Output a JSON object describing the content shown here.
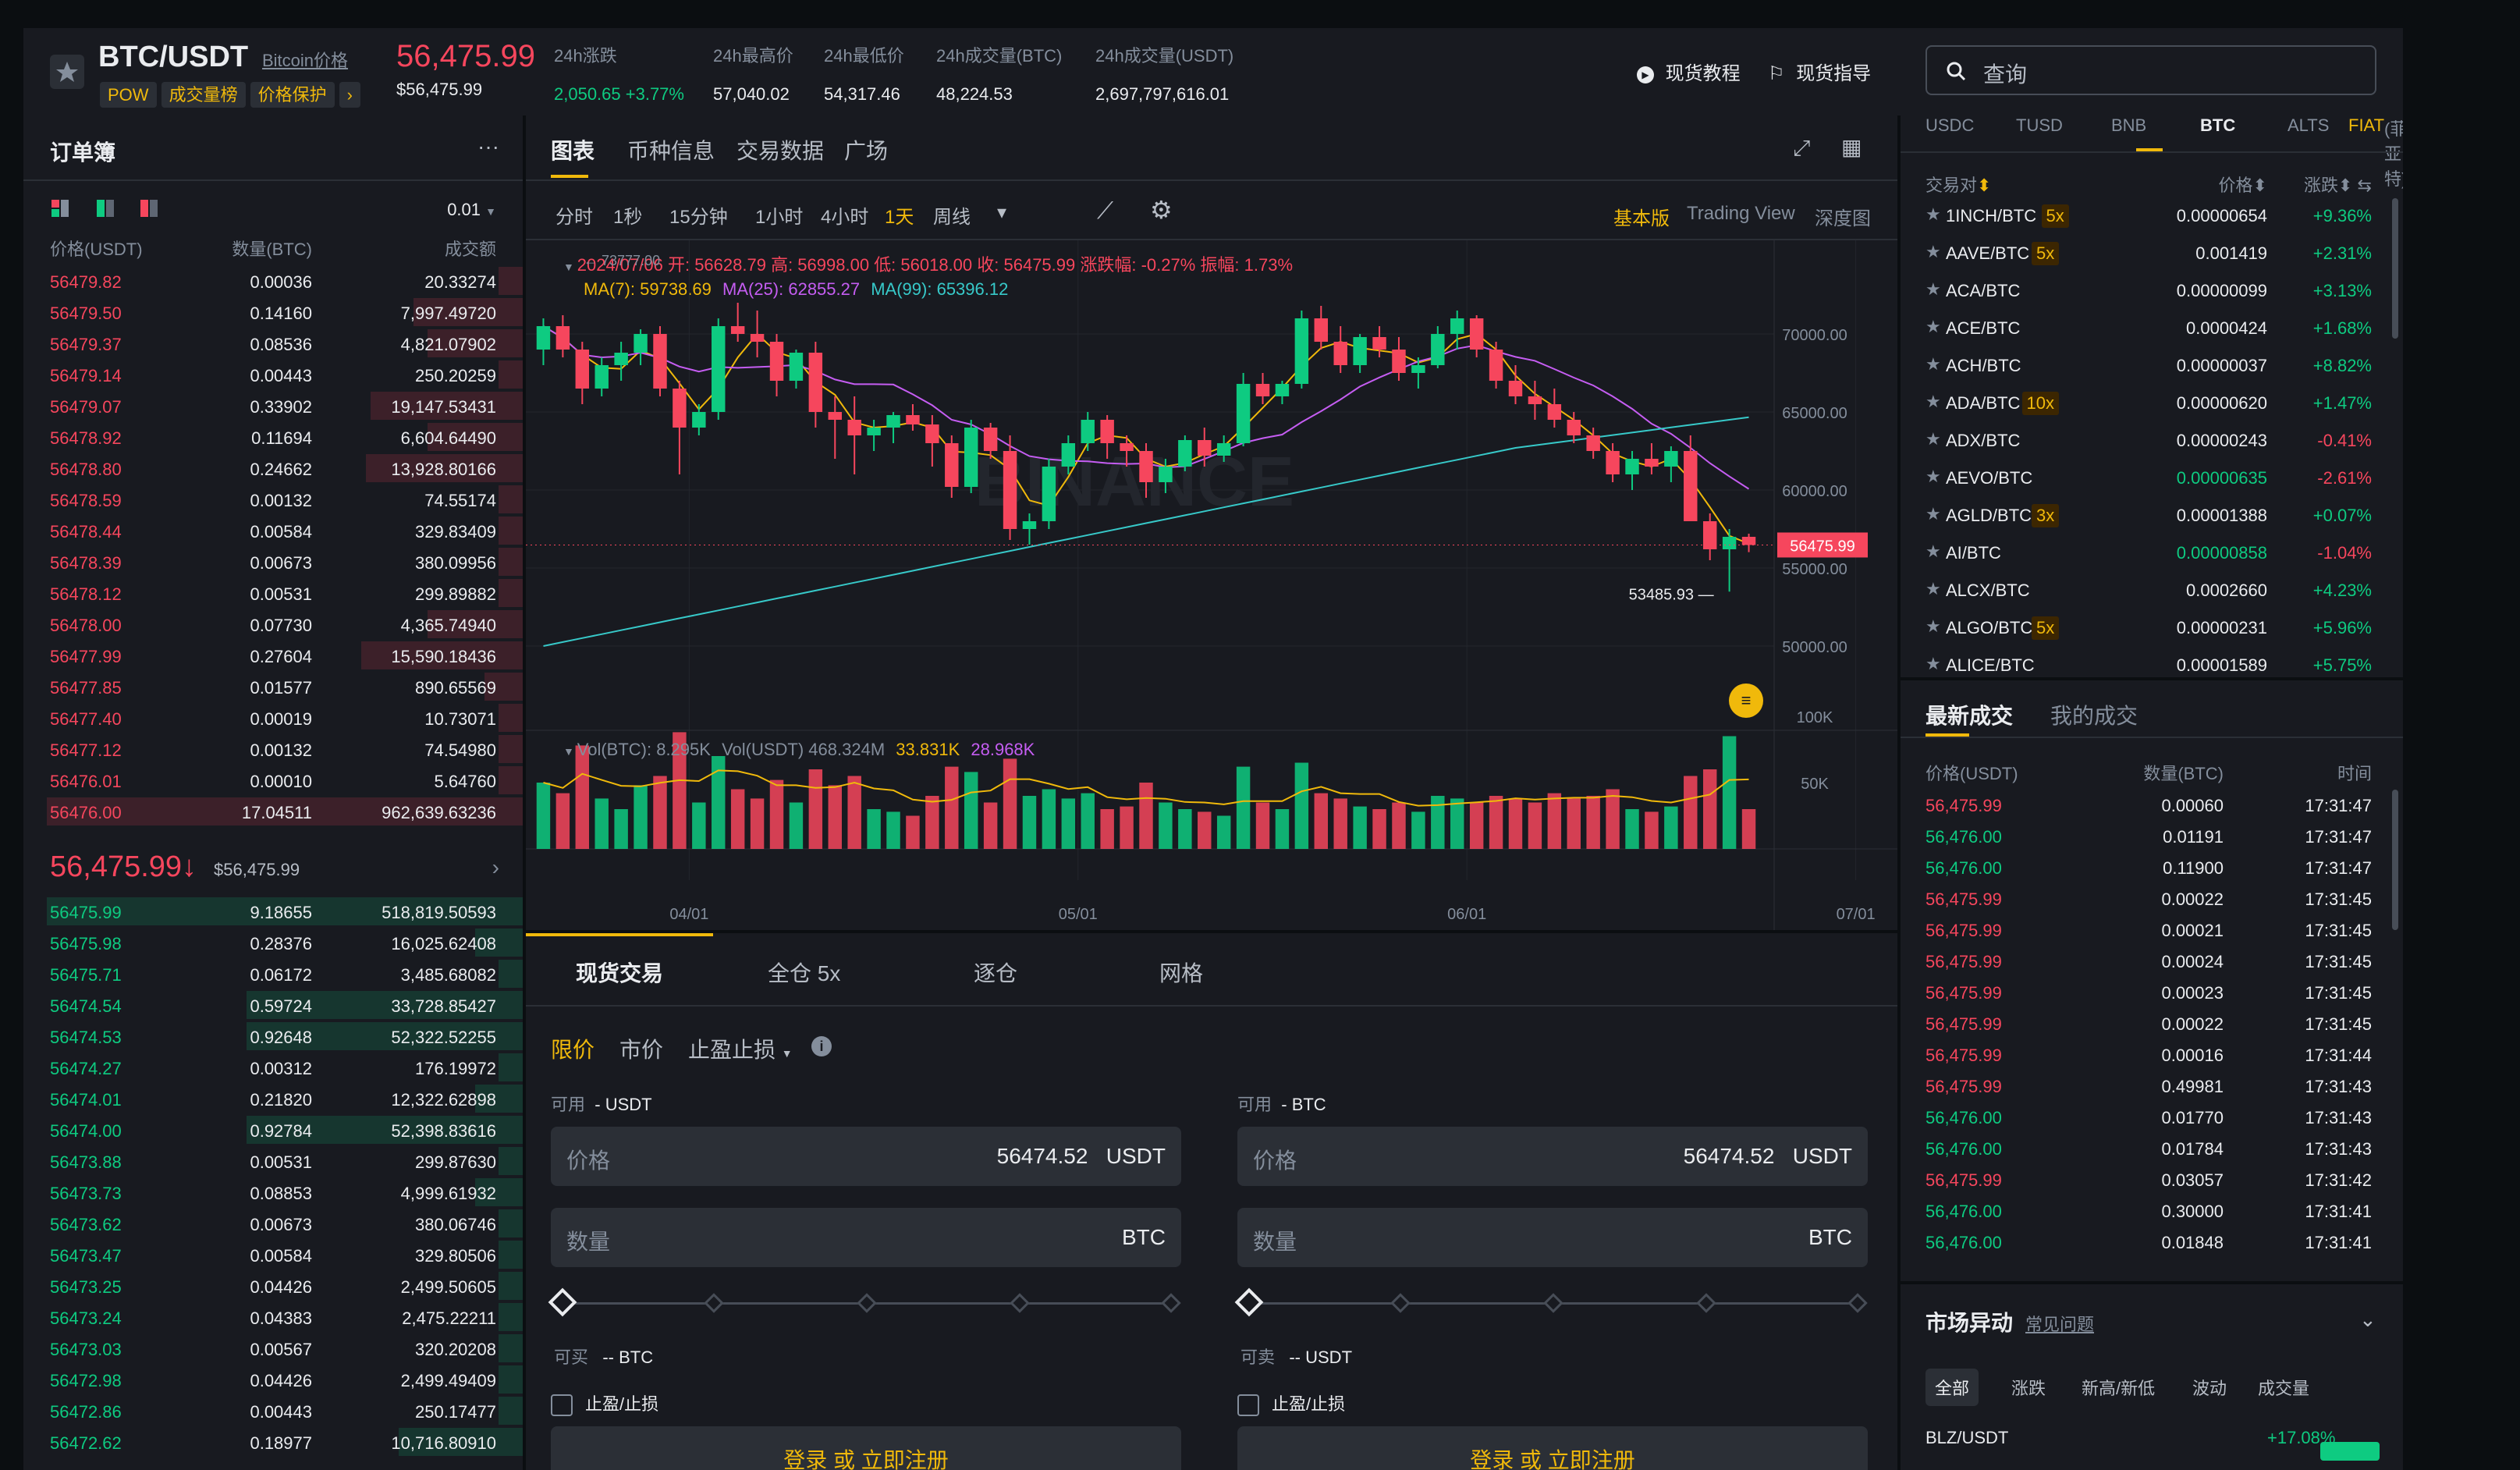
{
  "header": {
    "pair": "BTC/USDT",
    "link": "Bitcoin价格",
    "price": "56,475.99",
    "price_usd": "$56,475.99",
    "tags": [
      "POW",
      "成交量榜",
      "价格保护",
      "›"
    ],
    "stats": [
      {
        "label": "24h涨跌",
        "value": "2,050.65 +3.77%"
      },
      {
        "label": "24h最高价",
        "value": "57,040.02"
      },
      {
        "label": "24h最低价",
        "value": "54,317.46"
      },
      {
        "label": "24h成交量(BTC)",
        "value": "48,224.53"
      },
      {
        "label": "24h成交量(USDT)",
        "value": "2,697,797,616.01"
      }
    ],
    "tutorial": "现货教程",
    "guide": "现货指导"
  },
  "orderbook": {
    "title": "订单簿",
    "more": "···",
    "precision": "0.01",
    "cols": [
      "价格(USDT)",
      "数量(BTC)",
      "成交额"
    ],
    "asks": [
      [
        "56479.82",
        "0.00036",
        "20.33274"
      ],
      [
        "56479.50",
        "0.14160",
        "7,997.49720"
      ],
      [
        "56479.37",
        "0.08536",
        "4,821.07902"
      ],
      [
        "56479.14",
        "0.00443",
        "250.20259"
      ],
      [
        "56479.07",
        "0.33902",
        "19,147.53431"
      ],
      [
        "56478.92",
        "0.11694",
        "6,604.64490"
      ],
      [
        "56478.80",
        "0.24662",
        "13,928.80166"
      ],
      [
        "56478.59",
        "0.00132",
        "74.55174"
      ],
      [
        "56478.44",
        "0.00584",
        "329.83409"
      ],
      [
        "56478.39",
        "0.00673",
        "380.09956"
      ],
      [
        "56478.12",
        "0.00531",
        "299.89882"
      ],
      [
        "56478.00",
        "0.07730",
        "4,365.74940"
      ],
      [
        "56477.99",
        "0.27604",
        "15,590.18436"
      ],
      [
        "56477.85",
        "0.01577",
        "890.65569"
      ],
      [
        "56477.40",
        "0.00019",
        "10.73071"
      ],
      [
        "56477.12",
        "0.00132",
        "74.54980"
      ],
      [
        "56476.01",
        "0.00010",
        "5.64760"
      ],
      [
        "56476.00",
        "17.04511",
        "962,639.63236"
      ]
    ],
    "ask_depth": [
      0.05,
      0.23,
      0.2,
      0.05,
      0.32,
      0.2,
      0.33,
      0.05,
      0.05,
      0.05,
      0.05,
      0.2,
      0.34,
      0.08,
      0.05,
      0.05,
      0.05,
      1.0
    ],
    "mid_price": "56,475.99↓",
    "mid_usd": "$56,475.99",
    "mid_arrow": "›",
    "bids": [
      [
        "56475.99",
        "9.18655",
        "518,819.50593"
      ],
      [
        "56475.98",
        "0.28376",
        "16,025.62408"
      ],
      [
        "56475.71",
        "0.06172",
        "3,485.68082"
      ],
      [
        "56474.54",
        "0.59724",
        "33,728.85427"
      ],
      [
        "56474.53",
        "0.92648",
        "52,322.52255"
      ],
      [
        "56474.27",
        "0.00312",
        "176.19972"
      ],
      [
        "56474.01",
        "0.21820",
        "12,322.62898"
      ],
      [
        "56474.00",
        "0.92784",
        "52,398.83616"
      ],
      [
        "56473.88",
        "0.00531",
        "299.87630"
      ],
      [
        "56473.73",
        "0.08853",
        "4,999.61932"
      ],
      [
        "56473.62",
        "0.00673",
        "380.06746"
      ],
      [
        "56473.47",
        "0.00584",
        "329.80506"
      ],
      [
        "56473.25",
        "0.04426",
        "2,499.50605"
      ],
      [
        "56473.24",
        "0.04383",
        "2,475.22211"
      ],
      [
        "56473.03",
        "0.00567",
        "320.20208"
      ],
      [
        "56472.98",
        "0.04426",
        "2,499.49409"
      ],
      [
        "56472.86",
        "0.00443",
        "250.17477"
      ],
      [
        "56472.62",
        "0.18977",
        "10,716.80910"
      ]
    ],
    "bid_depth": [
      1.0,
      0.1,
      0.05,
      0.58,
      0.58,
      0.05,
      0.1,
      0.58,
      0.05,
      0.1,
      0.05,
      0.05,
      0.05,
      0.05,
      0.05,
      0.05,
      0.05,
      0.26
    ]
  },
  "chart": {
    "tabs": [
      "图表",
      "币种信息",
      "交易数据",
      "广场"
    ],
    "intervals": [
      "分时",
      "1秒",
      "15分钟",
      "1小时",
      "4小时",
      "1天",
      "周线",
      "▾"
    ],
    "views": [
      "基本版",
      "Trading View",
      "深度图"
    ],
    "ohlc_label": "2024/07/06 开: 56628.79 高: 56998.00 低: 56018.00 收: 56475.99 涨跌幅: -0.27% 振幅: 1.73%",
    "ma": {
      "ma7": "MA(7): 59738.69",
      "ma25": "MA(25): 62855.27",
      "ma99": "MA(99): 65396.12"
    },
    "high_mark": "73777.00",
    "low_mark": "53485.93",
    "last": "56475.99",
    "vol_label": {
      "v1": "Vol(BTC): 8.295K",
      "v2": "Vol(USDT) 468.324M",
      "v3": "33.831K",
      "v4": "28.968K"
    },
    "watermark": "BINANCE"
  },
  "chart_data": {
    "type": "line",
    "ylim": [
      45000,
      75000
    ],
    "y_ticks": [
      "70000.00",
      "65000.00",
      "60000.00",
      "55000.00",
      "50000.00"
    ],
    "x_ticks": [
      "04/01",
      "05/01",
      "06/01",
      "07/01"
    ],
    "vol_ticks": [
      "100K",
      "50K"
    ],
    "candles": [
      [
        69000,
        71000,
        68000,
        70500
      ],
      [
        70500,
        71200,
        68500,
        69000
      ],
      [
        69000,
        69500,
        65500,
        66500
      ],
      [
        66500,
        68500,
        66000,
        68000
      ],
      [
        68000,
        69500,
        67000,
        68800
      ],
      [
        68800,
        70300,
        68000,
        70000
      ],
      [
        70000,
        70500,
        66000,
        66500
      ],
      [
        66500,
        67000,
        61000,
        64000
      ],
      [
        64000,
        65500,
        63500,
        65000
      ],
      [
        65000,
        71000,
        64500,
        70500
      ],
      [
        70500,
        72000,
        69500,
        70000
      ],
      [
        70000,
        71500,
        68500,
        69500
      ],
      [
        69500,
        70000,
        66000,
        67000
      ],
      [
        67000,
        69000,
        66500,
        68800
      ],
      [
        68800,
        69500,
        64000,
        65000
      ],
      [
        65000,
        66000,
        62000,
        64500
      ],
      [
        64500,
        66000,
        61000,
        63500
      ],
      [
        63500,
        64500,
        62500,
        64000
      ],
      [
        64000,
        65000,
        63000,
        64800
      ],
      [
        64800,
        65500,
        63800,
        64200
      ],
      [
        64200,
        64800,
        61500,
        63000
      ],
      [
        63000,
        63500,
        59500,
        60200
      ],
      [
        60200,
        64500,
        59800,
        64000
      ],
      [
        64000,
        64300,
        62000,
        62500
      ],
      [
        62500,
        63500,
        56800,
        57500
      ],
      [
        57500,
        58500,
        56500,
        58000
      ],
      [
        58000,
        62000,
        57500,
        61500
      ],
      [
        61500,
        63500,
        61000,
        63000
      ],
      [
        63000,
        65000,
        62500,
        64500
      ],
      [
        64500,
        64800,
        62000,
        63000
      ],
      [
        63000,
        63500,
        61500,
        62500
      ],
      [
        62500,
        63000,
        59500,
        60500
      ],
      [
        60500,
        62000,
        59800,
        61500
      ],
      [
        61500,
        63500,
        61200,
        63200
      ],
      [
        63200,
        64000,
        61500,
        62200
      ],
      [
        62200,
        63500,
        61800,
        63000
      ],
      [
        63000,
        67500,
        62800,
        66800
      ],
      [
        66800,
        67500,
        65500,
        66000
      ],
      [
        66000,
        67000,
        65500,
        66800
      ],
      [
        66800,
        71500,
        66500,
        71000
      ],
      [
        71000,
        71800,
        69000,
        69500
      ],
      [
        69500,
        70500,
        67500,
        68000
      ],
      [
        68000,
        70000,
        67500,
        69800
      ],
      [
        69800,
        70500,
        68500,
        69000
      ],
      [
        69000,
        69800,
        67000,
        67500
      ],
      [
        67500,
        68500,
        66500,
        68000
      ],
      [
        68000,
        70500,
        67800,
        70000
      ],
      [
        70000,
        71500,
        69000,
        71000
      ],
      [
        71000,
        71200,
        68500,
        69000
      ],
      [
        69000,
        69500,
        66500,
        67000
      ],
      [
        67000,
        68000,
        65500,
        66000
      ],
      [
        66000,
        67000,
        64500,
        65500
      ],
      [
        65500,
        66500,
        64000,
        64500
      ],
      [
        64500,
        65000,
        63000,
        63500
      ],
      [
        63500,
        64000,
        62000,
        62500
      ],
      [
        62500,
        63000,
        60500,
        61000
      ],
      [
        61000,
        62500,
        60000,
        62000
      ],
      [
        62000,
        63000,
        61000,
        61500
      ],
      [
        61500,
        62800,
        60500,
        62500
      ],
      [
        62500,
        63500,
        58500,
        58000
      ],
      [
        58000,
        58500,
        55500,
        56200
      ],
      [
        56200,
        57500,
        53485,
        57000
      ],
      [
        57000,
        57200,
        56018,
        56476
      ]
    ],
    "volume": [
      50,
      42,
      78,
      38,
      30,
      48,
      55,
      88,
      35,
      70,
      45,
      38,
      52,
      35,
      60,
      48,
      55,
      30,
      28,
      25,
      40,
      62,
      58,
      35,
      68,
      40,
      45,
      38,
      42,
      30,
      32,
      50,
      35,
      30,
      28,
      25,
      62,
      35,
      30,
      65,
      42,
      38,
      32,
      30,
      35,
      28,
      40,
      38,
      35,
      40,
      38,
      35,
      42,
      38,
      40,
      45,
      30,
      28,
      32,
      55,
      60,
      85,
      30
    ]
  },
  "trade": {
    "tabs": [
      "现货交易",
      "全仓 5x",
      "逐仓",
      "网格"
    ],
    "types": [
      "限价",
      "市价",
      "止盈止损"
    ],
    "buy": {
      "avail_l": "可用",
      "avail_v": "- USDT",
      "price_l": "价格",
      "price_v": "56474.52",
      "price_u": "USDT",
      "qty_l": "数量",
      "qty_u": "BTC",
      "can_l": "可买",
      "can_v": "-- BTC",
      "tpsl": "止盈/止损",
      "btn": "登录 或 立即注册"
    },
    "sell": {
      "avail_l": "可用",
      "avail_v": "- BTC",
      "price_l": "价格",
      "price_v": "56474.52",
      "price_u": "USDT",
      "qty_l": "数量",
      "qty_u": "BTC",
      "can_l": "可卖",
      "can_v": "-- USDT",
      "tpsl": "止盈/止损",
      "btn": "登录 或 立即注册"
    }
  },
  "markets": {
    "search": "查询",
    "tabs": [
      "USDC",
      "TUSD",
      "BNB",
      "BTC",
      "ALTS",
      "FIAT",
      "(菲亚特)"
    ],
    "cols": [
      "交易对",
      "价格",
      "涨跌"
    ],
    "rows": [
      [
        "1INCH/BTC",
        "5x",
        "0.00000654",
        "+9.36%",
        "up"
      ],
      [
        "AAVE/BTC",
        "5x",
        "0.001419",
        "+2.31%",
        "up"
      ],
      [
        "ACA/BTC",
        "",
        "0.00000099",
        "+3.13%",
        "up"
      ],
      [
        "ACE/BTC",
        "",
        "0.0000424",
        "+1.68%",
        "up"
      ],
      [
        "ACH/BTC",
        "",
        "0.00000037",
        "+8.82%",
        "up"
      ],
      [
        "ADA/BTC",
        "10x",
        "0.00000620",
        "+1.47%",
        "up"
      ],
      [
        "ADX/BTC",
        "",
        "0.00000243",
        "-0.41%",
        "dn"
      ],
      [
        "AEVO/BTC",
        "",
        "0.00000635",
        "-2.61%",
        "dn"
      ],
      [
        "AGLD/BTC",
        "3x",
        "0.00001388",
        "+0.07%",
        "up"
      ],
      [
        "AI/BTC",
        "",
        "0.00000858",
        "-1.04%",
        "dn"
      ],
      [
        "ALCX/BTC",
        "",
        "0.0002660",
        "+4.23%",
        "up"
      ],
      [
        "ALGO/BTC",
        "5x",
        "0.00000231",
        "+5.96%",
        "up"
      ],
      [
        "ALICE/BTC",
        "",
        "0.00001589",
        "+5.75%",
        "up"
      ]
    ],
    "price_colors": [
      "w",
      "w",
      "w",
      "w",
      "w",
      "w",
      "w",
      "up",
      "w",
      "up",
      "w",
      "w",
      "w"
    ]
  },
  "recent": {
    "tabs": [
      "最新成交",
      "我的成交"
    ],
    "cols": [
      "价格(USDT)",
      "数量(BTC)",
      "时间"
    ],
    "rows": [
      [
        "56,475.99",
        "0.00060",
        "17:31:47",
        "dn"
      ],
      [
        "56,476.00",
        "0.01191",
        "17:31:47",
        "up"
      ],
      [
        "56,476.00",
        "0.11900",
        "17:31:47",
        "up"
      ],
      [
        "56,475.99",
        "0.00022",
        "17:31:45",
        "dn"
      ],
      [
        "56,475.99",
        "0.00021",
        "17:31:45",
        "dn"
      ],
      [
        "56,475.99",
        "0.00024",
        "17:31:45",
        "dn"
      ],
      [
        "56,475.99",
        "0.00023",
        "17:31:45",
        "dn"
      ],
      [
        "56,475.99",
        "0.00022",
        "17:31:45",
        "dn"
      ],
      [
        "56,475.99",
        "0.00016",
        "17:31:44",
        "dn"
      ],
      [
        "56,475.99",
        "0.49981",
        "17:31:43",
        "dn"
      ],
      [
        "56,476.00",
        "0.01770",
        "17:31:43",
        "up"
      ],
      [
        "56,476.00",
        "0.01784",
        "17:31:43",
        "up"
      ],
      [
        "56,475.99",
        "0.03057",
        "17:31:42",
        "dn"
      ],
      [
        "56,476.00",
        "0.30000",
        "17:31:41",
        "up"
      ],
      [
        "56,476.00",
        "0.01848",
        "17:31:41",
        "up"
      ]
    ]
  },
  "movers": {
    "title": "市场异动",
    "faq": "常见问题",
    "tabs": [
      "全部",
      "涨跌",
      "新高/新低",
      "波动",
      "成交量"
    ],
    "row": {
      "pair": "BLZ/USDT",
      "change": "+17.08%"
    }
  },
  "colors": {
    "up": "#0ecb81",
    "down": "#f6465d",
    "accent": "#f0b90b",
    "ma7": "#f0b90b",
    "ma25": "#c55df2",
    "ma99": "#37c9c9"
  }
}
